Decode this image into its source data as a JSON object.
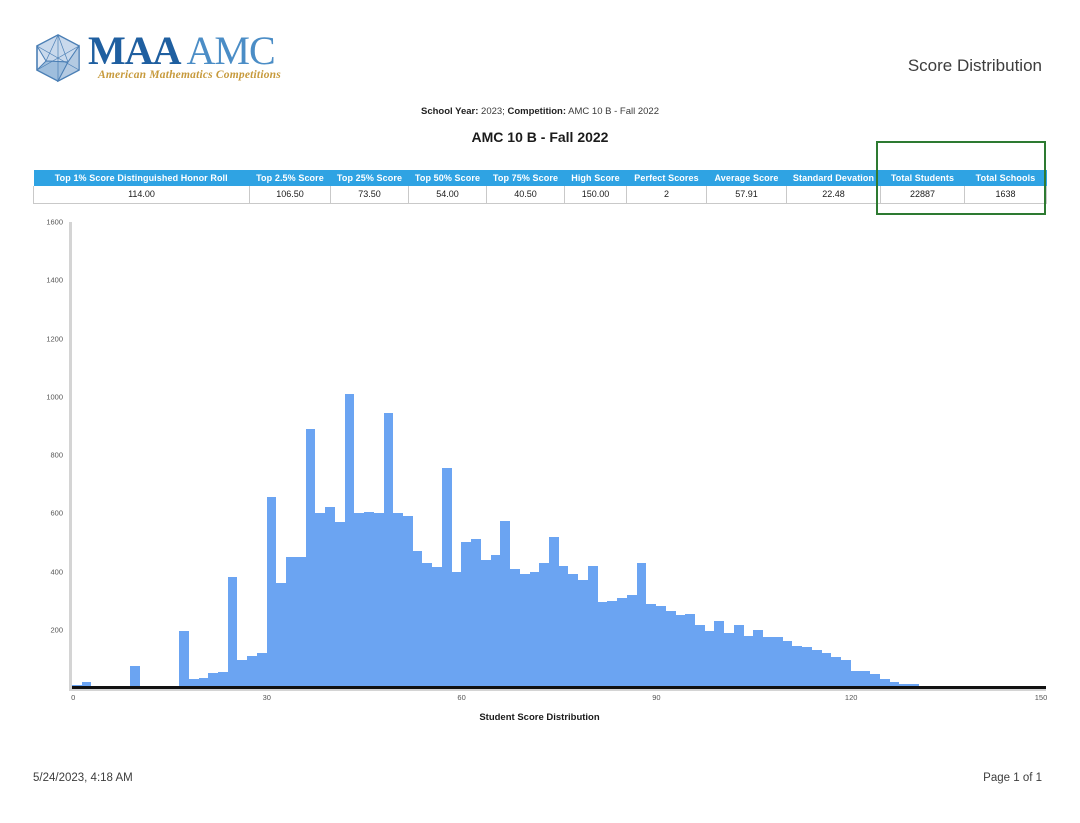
{
  "header": {
    "logo": {
      "maa": "MAA",
      "amc": "AMC",
      "tagline": "American Mathematics Competitions",
      "badge_icon": "polyhedron-logo-icon"
    },
    "report_title": "Score Distribution"
  },
  "subheader": {
    "school_year_label": "School Year:",
    "school_year_value": "2023;",
    "competition_label": "Competition:",
    "competition_value": "AMC 10 B - Fall 2022",
    "competition_title": "AMC 10 B - Fall 2022"
  },
  "stats_table": {
    "columns": [
      "Top 1% Score Distinguished Honor Roll",
      "Top 2.5% Score",
      "Top 25% Score",
      "Top 50% Score",
      "Top 75% Score",
      "High Score",
      "Perfect Scores",
      "Average Score",
      "Standard Devation",
      "Total Students",
      "Total Schools"
    ],
    "values": [
      "114.00",
      "106.50",
      "73.50",
      "54.00",
      "40.50",
      "150.00",
      "2",
      "57.91",
      "22.48",
      "22887",
      "1638"
    ],
    "header_bg": "#2FA3E3",
    "highlight_box_color": "#2D7A31",
    "highlighted_columns": [
      "Total Students",
      "Total Schools"
    ]
  },
  "footer": {
    "timestamp": "5/24/2023, 4:18 AM",
    "page_info": "Page 1 of 1"
  },
  "chart_data": {
    "type": "bar",
    "title": "",
    "xlabel": "Student Score Distribution",
    "ylabel": "",
    "xlim": [
      0,
      150
    ],
    "ylim": [
      0,
      1600
    ],
    "xticks": [
      0,
      30,
      60,
      90,
      120,
      150
    ],
    "yticks": [
      0,
      200,
      400,
      600,
      800,
      1000,
      1200,
      1400,
      1600
    ],
    "grid": false,
    "legend": null,
    "bar_color": "#6BA4F2",
    "bin_width": 1.5,
    "x": [
      0,
      1.5,
      3,
      4.5,
      6,
      7.5,
      9,
      10.5,
      12,
      13.5,
      15,
      16.5,
      18,
      19.5,
      21,
      22.5,
      24,
      25.5,
      27,
      28.5,
      30,
      31.5,
      33,
      34.5,
      36,
      37.5,
      39,
      40.5,
      42,
      43.5,
      45,
      46.5,
      48,
      49.5,
      51,
      52.5,
      54,
      55.5,
      57,
      58.5,
      60,
      61.5,
      63,
      64.5,
      66,
      67.5,
      69,
      70.5,
      72,
      73.5,
      75,
      76.5,
      78,
      79.5,
      81,
      82.5,
      84,
      85.5,
      87,
      88.5,
      90,
      91.5,
      93,
      94.5,
      96,
      97.5,
      99,
      100.5,
      102,
      103.5,
      105,
      106.5,
      108,
      109.5,
      111,
      112.5,
      114,
      115.5,
      117,
      118.5,
      120,
      121.5,
      123,
      124.5,
      126,
      127.5,
      129,
      130.5,
      132,
      133.5,
      135,
      136.5,
      138,
      139.5,
      141,
      142.5,
      144,
      145.5,
      148.5,
      150
    ],
    "values": [
      12,
      20,
      4,
      3,
      3,
      3,
      75,
      4,
      3,
      3,
      3,
      195,
      30,
      33,
      50,
      55,
      380,
      95,
      110,
      120,
      655,
      360,
      450,
      450,
      890,
      600,
      620,
      570,
      1010,
      600,
      605,
      600,
      945,
      600,
      590,
      470,
      430,
      415,
      755,
      400,
      500,
      510,
      440,
      455,
      575,
      410,
      390,
      400,
      430,
      520,
      420,
      390,
      370,
      420,
      295,
      300,
      310,
      320,
      430,
      290,
      280,
      265,
      250,
      255,
      215,
      195,
      230,
      190,
      215,
      180,
      200,
      175,
      175,
      160,
      145,
      140,
      130,
      120,
      105,
      95,
      60,
      58,
      48,
      30,
      20,
      15,
      14,
      8,
      7,
      5,
      4,
      4,
      3,
      3,
      3,
      3,
      3,
      3,
      3,
      3
    ]
  }
}
